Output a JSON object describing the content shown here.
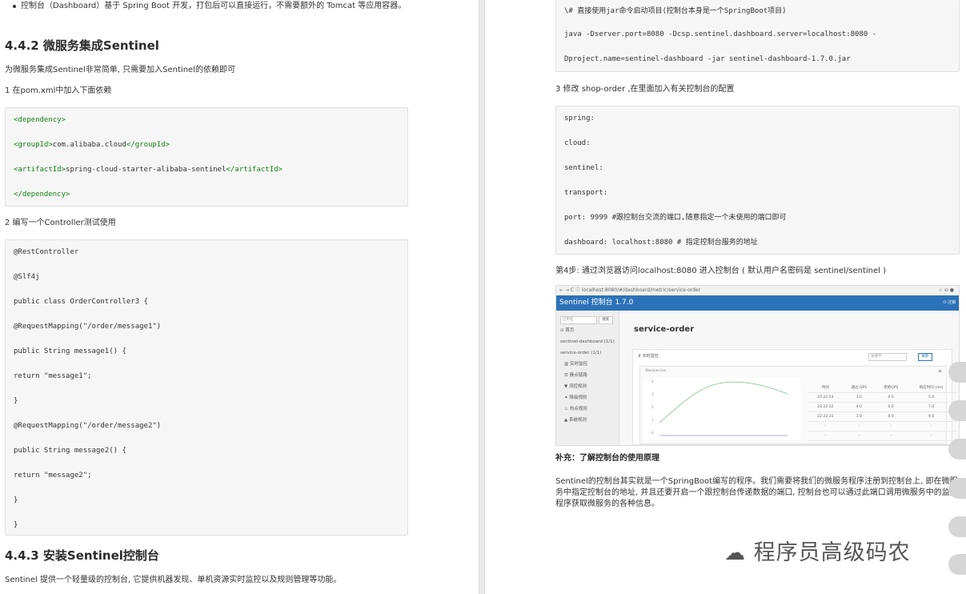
{
  "left": {
    "bullet": "控制台（Dashboard）基于 Spring Boot 开发，打包后可以直接运行，不需要额外的 Tomcat 等应用容器。",
    "h_442": "4.4.2 微服务集成Sentinel",
    "p_intro": "为微服务集成Sentinel非常简单, 只需要加入Sentinel的依赖即可",
    "p_step1": "1 在pom.xml中加入下面依赖",
    "pom": {
      "dep_open": "<dependency>",
      "group_open": "<groupId>",
      "group_val": "com.alibaba.cloud",
      "group_close": "</groupId>",
      "artifact_open": "<artifactId>",
      "artifact_val": "spring-cloud-starter-alibaba-sentinel",
      "artifact_close": "</artifactId>",
      "dep_close": "</dependency>"
    },
    "p_step2": "2 编写一个Controller测试使用",
    "controller": [
      "@RestController",
      "@Slf4j",
      "public class OrderController3 {",
      "@RequestMapping(\"/order/message1\")",
      "public String message1() {",
      "return \"message1\";",
      "}",
      "@RequestMapping(\"/order/message2\")",
      "public String message2() {",
      "return \"message2\";",
      "}",
      "}"
    ],
    "h_443": "4.4.3 安装Sentinel控制台",
    "p_bottom": "Sentinel 提供一个轻量级的控制台, 它提供机器发现、单机资源实时监控以及规则管理等功能。"
  },
  "right": {
    "cmd": [
      "\\# 直接使用jar命令启动项目(控制台本身是一个SpringBoot项目)",
      "java -Dserver.port=8080 -Dcsp.sentinel.dashboard.server=localhost:8080 -",
      "Dproject.name=sentinel-dashboard -jar sentinel-dashboard-1.7.0.jar"
    ],
    "p_step3": "3 修改 shop-order ,在里面加入有关控制台的配置",
    "yaml": [
      "spring:",
      "cloud:",
      "sentinel:",
      "transport:",
      "port: 9999 #跟控制台交流的端口,随意指定一个未使用的端口即可",
      "dashboard: localhost:8080 # 指定控制台服务的地址"
    ],
    "p_step4": "第4步: 通过浏览器访问localhost:8080 进入控制台 ( 默认用户名密码是 sentinel/sentinel )",
    "screenshot": {
      "url": "localhost:8080/#/dashboard/metric/service-order",
      "app_title": "Sentinel 控制台 1.7.0",
      "logout": "注销",
      "search_placeholder": "应用名",
      "search_btn": "搜索",
      "menu": [
        "首页",
        "sentinel-dashboard (1/1)",
        "service-order (1/1)",
        "实时监控",
        "簇点链路",
        "流控规则",
        "降级规则",
        "热点规则",
        "系统规则"
      ],
      "page_title": "service-order",
      "section": "实时监控",
      "keyword_placeholder": "关键字",
      "refresh_btn": "刷新",
      "resource": "/favicon.ico",
      "table_head": [
        "时间",
        "通过 QPS",
        "拒绝QPS",
        "响应时间 (ms)"
      ],
      "table_rows": [
        [
          "22:22:33",
          "3.0",
          "0.0",
          "5.0"
        ],
        [
          "22:22:32",
          "4.0",
          "0.0",
          "7.0"
        ],
        [
          "22:22:31",
          "1.0",
          "0.0",
          "9.0"
        ],
        [
          "-",
          "-",
          "-",
          "-"
        ],
        [
          "-",
          "-",
          "-",
          "-"
        ]
      ],
      "y_ticks": [
        "4",
        "3",
        "2",
        "1",
        "0"
      ]
    },
    "h_supp": "补充：了解控制台的使用原理",
    "p_supp": "Sentinel的控制台其实就是一个SpringBoot编写的程序。我们需要将我们的微服务程序注册到控制台上, 即在微服务中指定控制台的地址, 并且还要开启一个跟控制台传递数据的端口, 控制台也可以通过此端口调用微服务中的监控程序获取微服务的各种信息。",
    "watermark": "程序员高级码农"
  }
}
